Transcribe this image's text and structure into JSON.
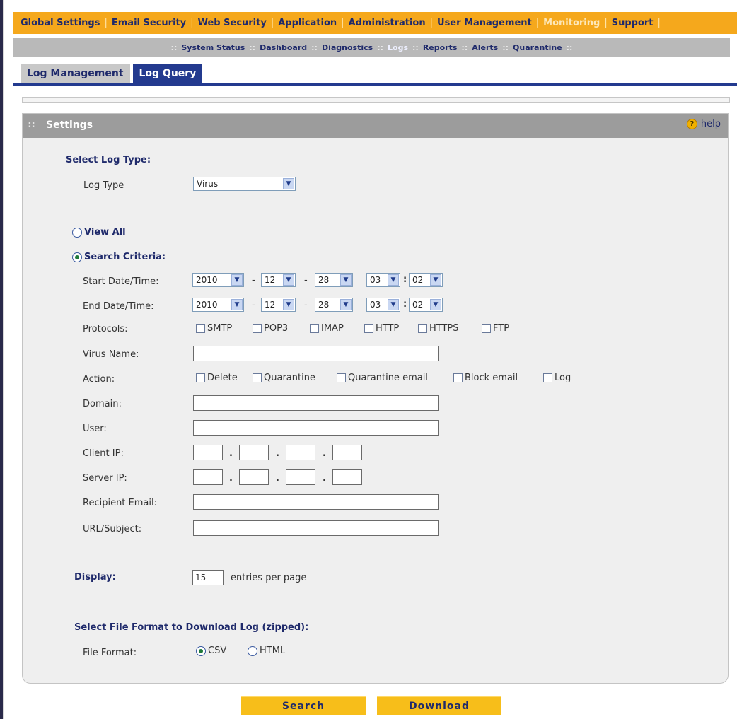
{
  "top_nav": [
    {
      "label": "Global Settings",
      "active": false
    },
    {
      "label": "Email Security",
      "active": false
    },
    {
      "label": "Web Security",
      "active": false
    },
    {
      "label": "Application",
      "active": false
    },
    {
      "label": "Administration",
      "active": false
    },
    {
      "label": "User Management",
      "active": false
    },
    {
      "label": "Monitoring",
      "active": true
    },
    {
      "label": "Support",
      "active": false
    }
  ],
  "sub_nav": [
    {
      "label": "System Status"
    },
    {
      "label": "Dashboard"
    },
    {
      "label": "Diagnostics"
    },
    {
      "label": "Logs"
    },
    {
      "label": "Reports"
    },
    {
      "label": "Alerts"
    },
    {
      "label": "Quarantine"
    }
  ],
  "tabs": [
    {
      "label": "Log Management",
      "active": false
    },
    {
      "label": "Log Query",
      "active": true
    }
  ],
  "panel": {
    "title": "Settings",
    "help": "help"
  },
  "form": {
    "select_log_type": "Select Log Type:",
    "log_type_label": "Log Type",
    "log_type_value": "Virus",
    "view_all": "View All",
    "search_criteria": "Search Criteria:",
    "mode_selected": "search_criteria",
    "start_label": "Start Date/Time:",
    "end_label": "End Date/Time:",
    "start": {
      "year": "2010",
      "month": "12",
      "day": "28",
      "hour": "03",
      "minute": "02"
    },
    "end": {
      "year": "2010",
      "month": "12",
      "day": "28",
      "hour": "03",
      "minute": "02"
    },
    "date_sep": "-",
    "time_sep": ":",
    "protocols_label": "Protocols:",
    "protocols": [
      "SMTP",
      "POP3",
      "IMAP",
      "HTTP",
      "HTTPS",
      "FTP"
    ],
    "virus_name_label": "Virus Name:",
    "virus_name_value": "",
    "action_label": "Action:",
    "actions": [
      "Delete",
      "Quarantine",
      "Quarantine email",
      "Block email",
      "Log"
    ],
    "domain_label": "Domain:",
    "domain_value": "",
    "user_label": "User:",
    "user_value": "",
    "client_ip_label": "Client IP:",
    "server_ip_label": "Server IP:",
    "ip_sep": ".",
    "recipient_label": "Recipient Email:",
    "recipient_value": "",
    "url_subject_label": "URL/Subject:",
    "url_subject_value": "",
    "display_label": "Display:",
    "display_value": "15",
    "display_suffix": "entries per page",
    "file_format_heading": "Select File Format to Download Log (zipped):",
    "file_format_label": "File Format:",
    "file_formats": [
      "CSV",
      "HTML"
    ],
    "file_format_selected": "CSV"
  },
  "buttons": {
    "search": "Search",
    "download": "Download"
  },
  "colors": {
    "top_nav_bg": "#f5a81c",
    "sub_nav_bg": "#b9b9b9",
    "tab_active_bg": "#233a8f",
    "button_bg": "#f7be1a",
    "nav_text": "#1f2a6b"
  },
  "icons": {
    "help": "help-icon",
    "grip": "grip-icon",
    "dropdown": "chevron-down-icon"
  }
}
